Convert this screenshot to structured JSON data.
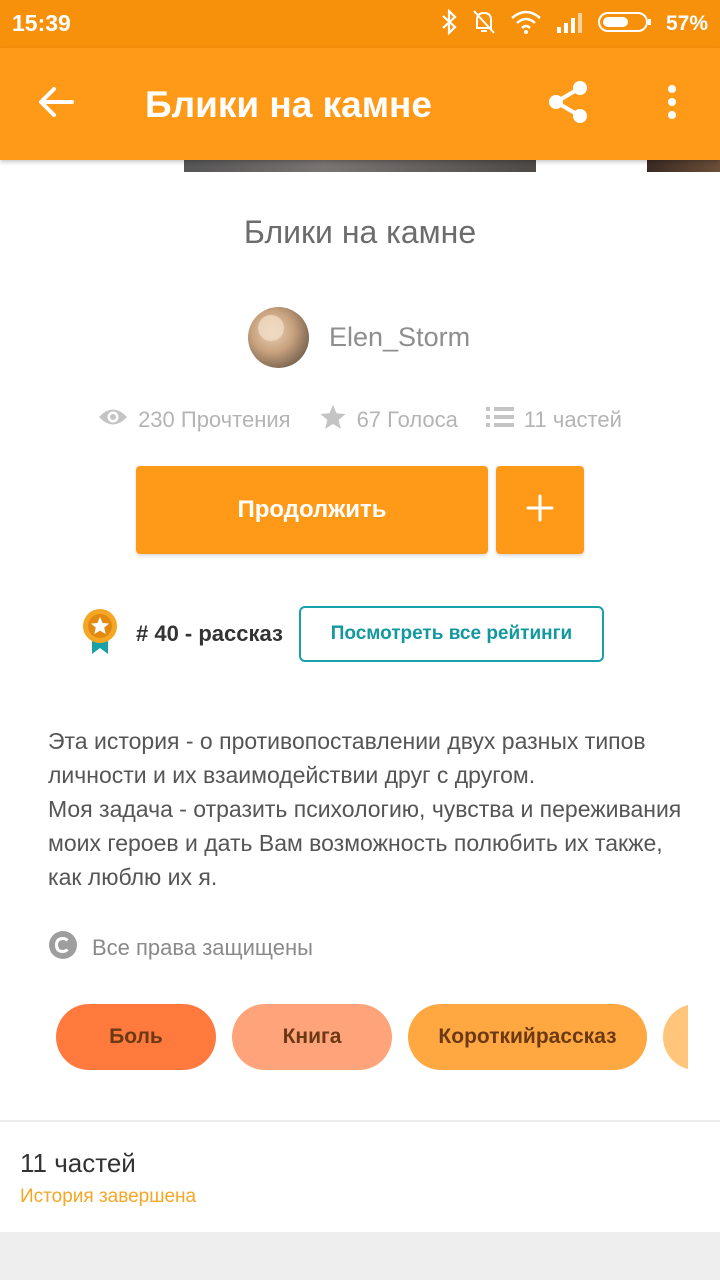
{
  "status_bar": {
    "time": "15:39",
    "battery_percent": "57%",
    "icons": [
      "bluetooth-icon",
      "notifications-off-icon",
      "wifi-icon",
      "signal-icon",
      "battery-icon"
    ]
  },
  "app_bar": {
    "title": "Блики на камне",
    "icons": [
      "back-arrow-icon",
      "share-icon",
      "more-vert-icon"
    ]
  },
  "story": {
    "title": "Блики на камне",
    "author": "Elen_Storm",
    "stats": {
      "reads": "230 Прочтения",
      "votes": "67 Голоса",
      "parts": "11 частей"
    }
  },
  "actions": {
    "continue_label": "Продолжить",
    "add_label": "+"
  },
  "ranking": {
    "text": "# 40 - рассказ",
    "view_all_label": "Посмотреть все рейтинги"
  },
  "description": {
    "paragraphs": [
      "Эта история - о противопоставлении двух разных типов личности и их взаимодействии друг с другом.",
      "Моя задача - отразить психологию, чувства и переживания моих героев и дать Вам возможность полюбить их также, как люблю их я."
    ]
  },
  "copyright": "Все права защищены",
  "tags": [
    "Боль",
    "Книга",
    "Короткийрассказ",
    ""
  ],
  "table_of_contents": {
    "parts_count": "11 частей",
    "status": "История завершена"
  },
  "colors": {
    "accent": "#ff9a19",
    "status_bar": "#f7900b",
    "teal": "#1aa0a8",
    "completed": "#f5a623"
  }
}
